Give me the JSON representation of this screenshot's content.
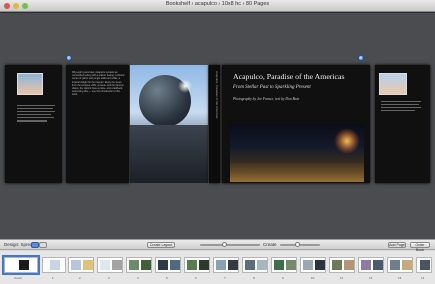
{
  "window": {
    "title": "Bookshelf ›  acapulco  ›  10x8 hc  ›  80 Pages"
  },
  "spread": {
    "left_page_text": "Fifty-eight years later, Acapulco remains an uncrowded setting with a classic feeling; a historic center of palms and jungle walks and villas, a tropical delight for the traveler: Enjoy the views from the terraces, cliffs, sunsets, and the famous divers, the visitors have a place, and a laidback, welcoming vibe — see the introduction to this book.",
    "spine": "Acapulco, Paradise of the Americas",
    "book_title": "Acapulco, Paradise of the Americas",
    "book_subtitle": "From Stellar Past to Sparkling Present",
    "credit": "Photography by Joe Farace, text by Don Baia"
  },
  "toolbar": {
    "view_label": "Design: Spreads",
    "layout_button": "Create Layout",
    "create_label": "Create",
    "left_button": "Add Page",
    "right_button": "Order Book"
  },
  "strip": {
    "labels": [
      "Cover",
      "1",
      "2",
      "3",
      "4",
      "5",
      "6",
      "7",
      "8",
      "9",
      "10",
      "11",
      "12",
      "13",
      "14",
      "15",
      "16"
    ]
  },
  "colors": {
    "accent": "#3f78d4",
    "canvas": "#4b4c4f"
  }
}
